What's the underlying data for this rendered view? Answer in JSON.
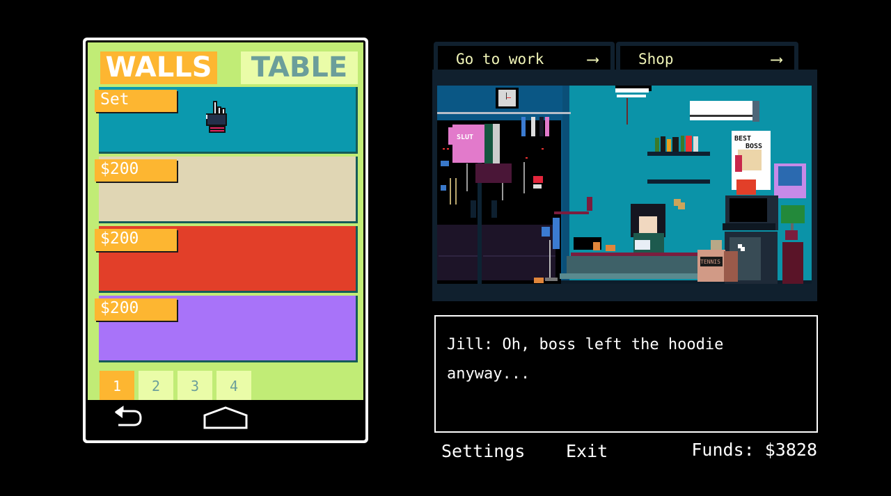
{
  "phone": {
    "category_tabs": [
      {
        "label": "WALLS",
        "active": true
      },
      {
        "label": "TABLE",
        "active": false
      }
    ],
    "swatches": [
      {
        "tag": "Set",
        "color": "#0b99ae",
        "state": "equipped"
      },
      {
        "tag": "$200",
        "color": "#e0d6b4",
        "state": "for-sale"
      },
      {
        "tag": "$200",
        "color": "#e23f29",
        "state": "for-sale"
      },
      {
        "tag": "$200",
        "color": "#a873f9",
        "state": "for-sale"
      }
    ],
    "pages": [
      {
        "label": "1",
        "active": true
      },
      {
        "label": "2",
        "active": false
      },
      {
        "label": "3",
        "active": false
      },
      {
        "label": "4",
        "active": false
      }
    ],
    "nav": {
      "back_icon": "back-arrow-icon",
      "home_icon": "home-icon"
    }
  },
  "scene_tabs": [
    {
      "label": "Go to work",
      "arrow": "⟶"
    },
    {
      "label": "Shop",
      "arrow": "⟶"
    }
  ],
  "scene": {
    "shirt_text": "SLUT",
    "poster_line1": "BEST",
    "poster_line2": "BOSS",
    "box_text": "TENNIS"
  },
  "dialog": {
    "speaker": "Jill",
    "text": "Jill: Oh, boss left the hoodie anyway..."
  },
  "footer": {
    "settings_label": "Settings",
    "exit_label": "Exit",
    "funds_label": "Funds: $3828"
  },
  "colors": {
    "accent_orange": "#fdb631",
    "phone_bg": "#c1ec76",
    "tab_inactive_bg": "#eafca8",
    "tab_inactive_text": "#6b9e9a",
    "scene_tab_text": "#f1f5b8"
  }
}
